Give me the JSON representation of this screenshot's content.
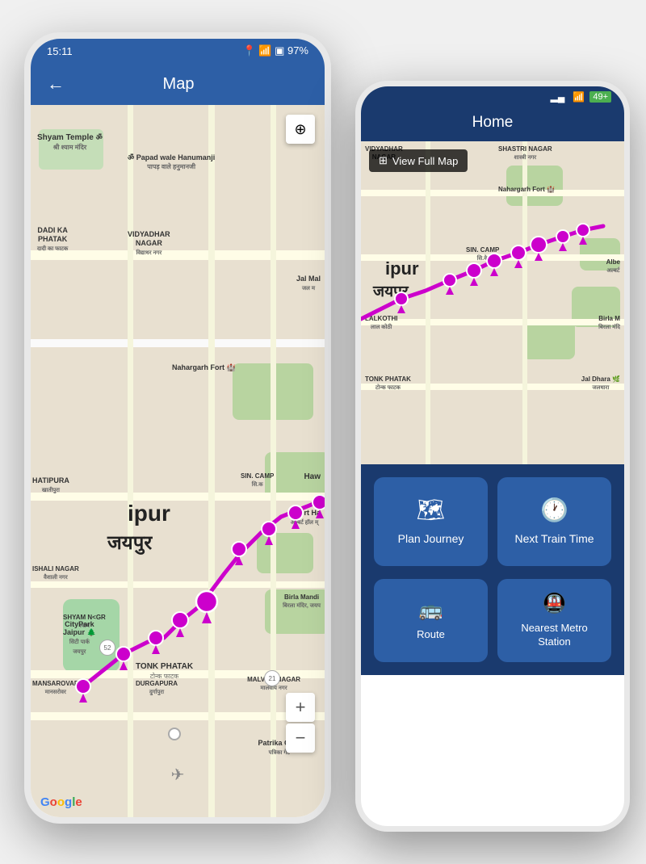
{
  "phone1": {
    "status": {
      "time": "15:11",
      "location_icon": "📍",
      "wifi_icon": "WiFi",
      "battery": "97%"
    },
    "header": {
      "back_label": "←",
      "title": "Map"
    },
    "map": {
      "compass_icon": "⊕",
      "zoom_in": "+",
      "zoom_out": "−",
      "google_label": "Google",
      "places": [
        {
          "name": "Shyam Temple",
          "name_hi": "श्री श्याम मंदिर"
        },
        {
          "name": "Papad wale Hanumanji",
          "name_hi": "पापड़ वाले हनुमानजी"
        },
        {
          "name": "Dadi Ka Phatak",
          "name_hi": "दादी का फाटक"
        },
        {
          "name": "Vidyadhar Nagar",
          "name_hi": "विद्याधर नगर"
        },
        {
          "name": "Jal Mahal",
          "name_hi": "जल म"
        },
        {
          "name": "Nahargarh Fort"
        },
        {
          "name": "Hatipura",
          "name_hi": "खातीपुरा"
        },
        {
          "name": "Sinc Camp",
          "name_hi": "सि.क"
        },
        {
          "name": "Hawa Mahal"
        },
        {
          "name": "ipur",
          "name_hi": "जयपुर"
        },
        {
          "name": "Albert Hall",
          "name_hi": "अल्बर्ट हॉल म्"
        },
        {
          "name": "Vaishali Nagar",
          "name_hi": "वैशाली नगर"
        },
        {
          "name": "Shyam Nagar",
          "name_hi": "श्याम"
        },
        {
          "name": "Birla Mandir",
          "name_hi": "बिरला मंदिर, जयप"
        },
        {
          "name": "Tonk Phatak",
          "name_hi": "टोन्क फाटक"
        },
        {
          "name": "CityPark Jaipur",
          "name_hi": "सिटी पार्क\nजयपुर"
        },
        {
          "name": "Mansarovar",
          "name_hi": "मानसरोवर"
        },
        {
          "name": "Durgapura",
          "name_hi": "दुर्गापुरा"
        },
        {
          "name": "Malviya Nagar",
          "name_hi": "मालवीय नगर"
        },
        {
          "name": "Patrika Gate",
          "name_hi": "पत्रिका गेट"
        }
      ]
    }
  },
  "phone2": {
    "status": {
      "signal": "▂▄",
      "wifi": "WiFi",
      "battery": "49+"
    },
    "header": {
      "title": "Home"
    },
    "map": {
      "view_full_map_icon": "⊞",
      "view_full_map_label": "View Full Map",
      "places": [
        {
          "name": "Vidyadhar Nagar"
        },
        {
          "name": "Shastri Nagar",
          "name_hi": "शास्त्री नगर"
        },
        {
          "name": "Nahargarh Fort"
        },
        {
          "name": "Sinc Camp",
          "name_hi": "सि.के"
        },
        {
          "name": "ipur",
          "name_hi": "जयपुर"
        },
        {
          "name": "Albert Hall"
        },
        {
          "name": "Lal Kothi",
          "name_hi": "लाल कोठी"
        },
        {
          "name": "Birla Mandir"
        },
        {
          "name": "Tonk Phatak",
          "name_hi": "टोन्क फाटक"
        },
        {
          "name": "Jal Dhara",
          "name_hi": "जलधारा"
        }
      ]
    },
    "buttons": [
      {
        "id": "plan-journey",
        "icon": "🗺",
        "label": "Plan Journey"
      },
      {
        "id": "next-train-time",
        "icon": "🕐",
        "label": "Next Train Time"
      },
      {
        "id": "route",
        "icon": "🚌",
        "label": "Route"
      },
      {
        "id": "nearest-metro",
        "icon": "🚇",
        "label": "Nearest Metro Station"
      }
    ]
  }
}
